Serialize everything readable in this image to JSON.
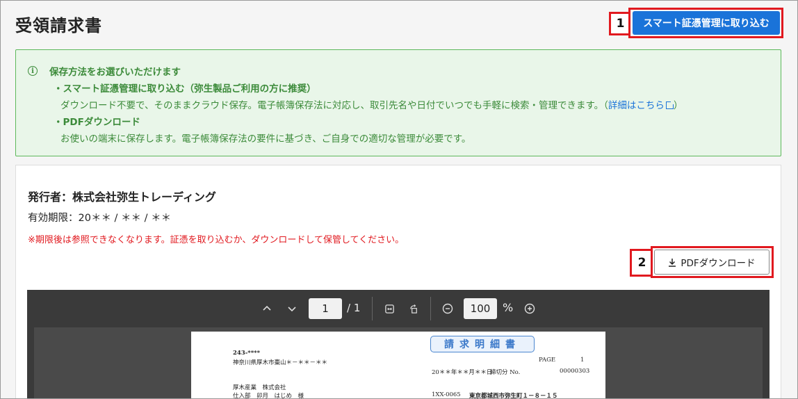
{
  "page": {
    "title": "受領請求書"
  },
  "callouts": [
    "1",
    "2"
  ],
  "actions": {
    "smart_import_label": "スマート証憑管理に取り込む",
    "pdf_download_label": "PDFダウンロード"
  },
  "info": {
    "heading": "保存方法をお選びいただけます",
    "option1_title": "・スマート証憑管理に取り込む（弥生製品ご利用の方に推奨）",
    "option1_desc": "ダウンロード不要で、そのままクラウド保存。電子帳簿保存法に対応し、取引先名や日付でいつでも手軽に検索・管理できます。（",
    "option1_link": "詳細はこちら",
    "option1_close": "）",
    "option2_title": "・PDFダウンロード",
    "option2_desc": "お使いの端末に保存します。電子帳簿保存法の要件に基づき、ご自身での適切な管理が必要です。",
    "icon": "info-circle-icon"
  },
  "card": {
    "issuer": "発行者：株式会社弥生トレーディング",
    "expiry": "有効期限：20＊＊ / ＊＊ / ＊＊",
    "warning": "※期限後は参照できなくなります。証憑を取り込むか、ダウンロードして保管してください。"
  },
  "viewer": {
    "current_page": "1",
    "total_pages": "/ 1",
    "zoom": "100",
    "zoom_unit": "%"
  },
  "document": {
    "postal": "243-****",
    "address": "神奈川県厚木市棗山＊－＊＊－＊＊",
    "company": "厚木産業　株式会社",
    "person": "仕入部　卯月　はじめ　様",
    "title": "請求明細書",
    "page_label": "PAGE",
    "page_no": "1",
    "date": "20＊＊年＊＊月＊＊日",
    "cutoff_label": "締切分 No.",
    "doc_no": "00000303",
    "issuer_code": "1XX-0065",
    "issuer_address": "東京都城西市弥生町１－８－１５"
  },
  "colors": {
    "accent": "#1a73d9",
    "info_bg": "#e9f6e9",
    "info_text": "#3c8b3a",
    "warning": "#e1191f",
    "callout_border": "#e1191f"
  }
}
